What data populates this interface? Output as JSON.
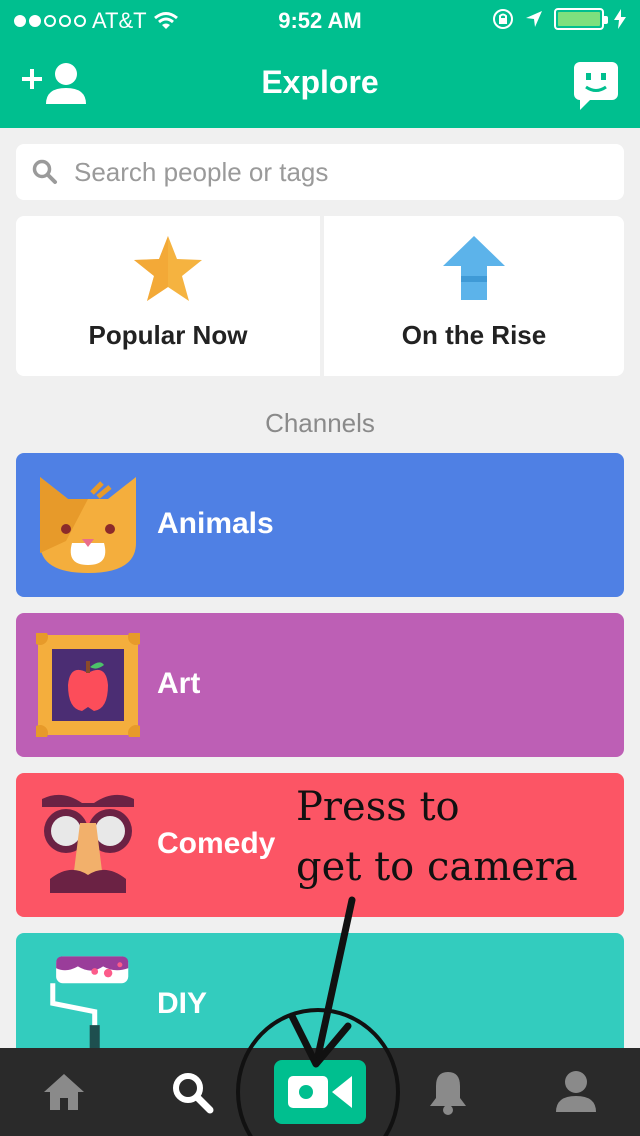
{
  "status_bar": {
    "carrier": "AT&T",
    "time": "9:52 AM"
  },
  "header": {
    "title": "Explore"
  },
  "search": {
    "placeholder": "Search people or tags"
  },
  "featured": [
    {
      "label": "Popular Now",
      "icon": "star-icon"
    },
    {
      "label": "On the Rise",
      "icon": "up-arrow-icon"
    }
  ],
  "section_title": "Channels",
  "channels": [
    {
      "label": "Animals",
      "icon": "cat-icon",
      "color": "#4f80e4"
    },
    {
      "label": "Art",
      "icon": "framed-apple-icon",
      "color": "#bd5fb5"
    },
    {
      "label": "Comedy",
      "icon": "disguise-glasses-icon",
      "color": "#fc5565"
    },
    {
      "label": "DIY",
      "icon": "paint-roller-icon",
      "color": "#33ccbe"
    }
  ],
  "annotation": {
    "line1": "Press to",
    "line2": "get to camera"
  },
  "colors": {
    "brand": "#00bf8f",
    "tabbar": "#2a2a2a",
    "background": "#f0f0f0"
  }
}
